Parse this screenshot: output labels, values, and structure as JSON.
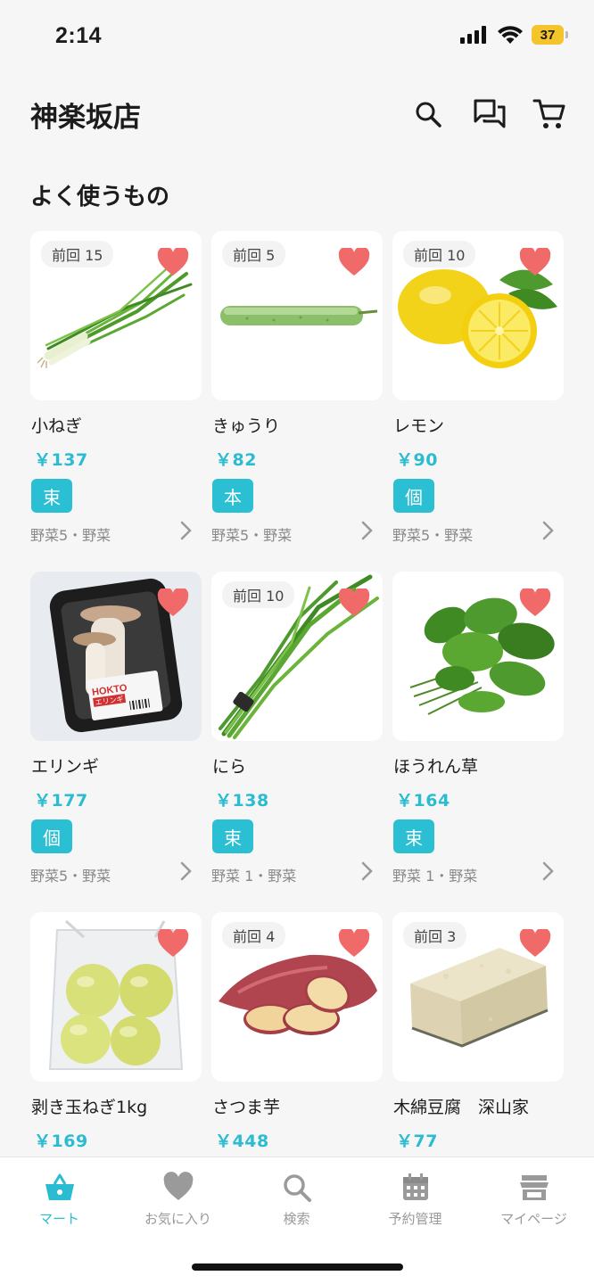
{
  "status_bar": {
    "time": "2:14",
    "battery": "37"
  },
  "header": {
    "title": "神楽坂店"
  },
  "section": {
    "title": "よく使うもの"
  },
  "products": [
    {
      "name": "小ねぎ",
      "price": "￥137",
      "unit": "束",
      "category": "野菜5・野菜",
      "last": "前回 15"
    },
    {
      "name": "きゅうり",
      "price": "￥82",
      "unit": "本",
      "category": "野菜5・野菜",
      "last": "前回 5"
    },
    {
      "name": "レモン",
      "price": "￥90",
      "unit": "個",
      "category": "野菜5・野菜",
      "last": "前回 10"
    },
    {
      "name": "エリンギ",
      "price": "￥177",
      "unit": "個",
      "category": "野菜5・野菜",
      "last": ""
    },
    {
      "name": "にら",
      "price": "￥138",
      "unit": "束",
      "category": "野菜 1・野菜",
      "last": "前回 10"
    },
    {
      "name": "ほうれん草",
      "price": "￥164",
      "unit": "束",
      "category": "野菜 1・野菜",
      "last": ""
    },
    {
      "name": "剥き玉ねぎ1kg",
      "price": "￥169",
      "unit": "",
      "category": "",
      "last": ""
    },
    {
      "name": "さつま芋",
      "price": "￥448",
      "unit": "",
      "category": "",
      "last": "前回 4"
    },
    {
      "name": "木綿豆腐　深山家",
      "price": "￥77",
      "unit": "",
      "category": "",
      "last": "前回 3"
    }
  ],
  "product_image_text": {
    "eringi_brand": "HOKTO",
    "eringi_label": "エリンギ"
  },
  "nav": [
    {
      "label": "マート",
      "icon": "basket-icon"
    },
    {
      "label": "お気に入り",
      "icon": "heart-icon"
    },
    {
      "label": "検索",
      "icon": "search-icon"
    },
    {
      "label": "予約管理",
      "icon": "calendar-icon"
    },
    {
      "label": "マイページ",
      "icon": "store-icon"
    }
  ],
  "colors": {
    "accent": "#2bbcd1",
    "heart": "#f06a6a",
    "background": "#f6f6f6"
  }
}
